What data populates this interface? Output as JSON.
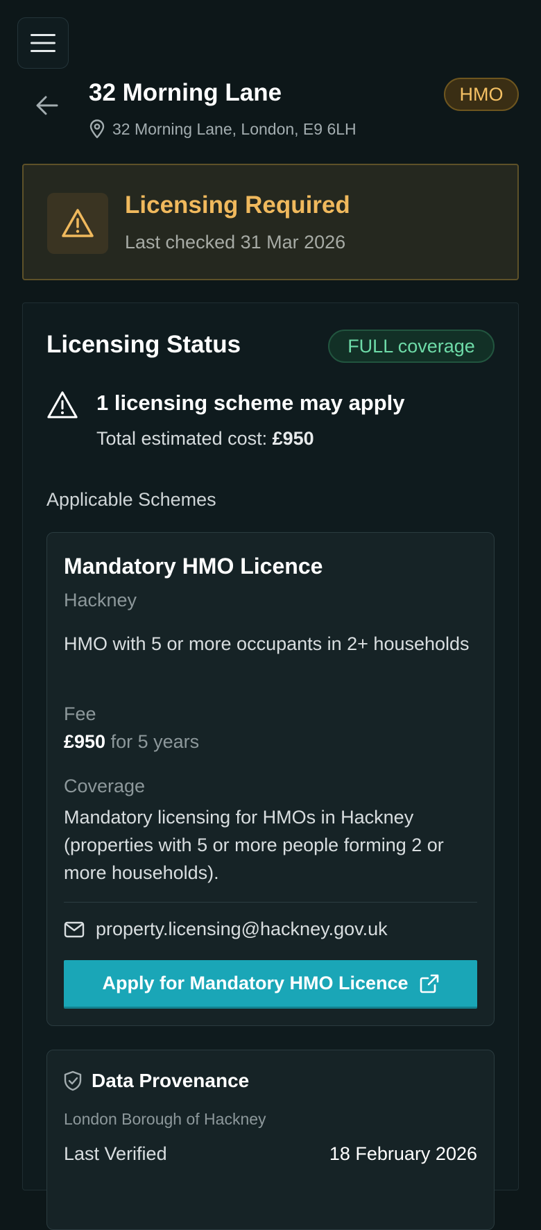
{
  "header": {
    "title": "32 Morning Lane",
    "address": "32 Morning Lane, London, E9 6LH",
    "badge": "HMO",
    "menu_icon": "hamburger-icon",
    "back_icon": "arrow-left-icon",
    "location_icon": "map-pin-icon"
  },
  "banner": {
    "title": "Licensing Required",
    "subtitle": "Last checked 31 Mar 2026",
    "icon": "warning-triangle-icon"
  },
  "status": {
    "title": "Licensing Status",
    "coverage": "FULL coverage",
    "summary_title": "1 licensing scheme may apply",
    "cost_label": "Total estimated cost: ",
    "cost_value": "£950",
    "applicable_label": "Applicable Schemes"
  },
  "scheme": {
    "name": "Mandatory HMO Licence",
    "authority": "Hackney",
    "description": "HMO with 5 or more occupants in 2+ households",
    "fee_label": "Fee",
    "fee_amount": "£950",
    "fee_period": " for 5 years",
    "coverage_label": "Coverage",
    "coverage_text": "Mandatory licensing for HMOs in Hackney (properties with 5 or more people forming 2 or more households).",
    "email": "property.licensing@hackney.gov.uk",
    "apply_label": "Apply for Mandatory HMO Licence"
  },
  "provenance": {
    "title": "Data Provenance",
    "source": "London Borough of Hackney",
    "verified_label": "Last Verified",
    "verified_value": "18 February 2026"
  },
  "colors": {
    "background": "#0d1719",
    "accent": "#1aa6b7",
    "warning": "#f0b95d",
    "success": "#6edba8"
  }
}
